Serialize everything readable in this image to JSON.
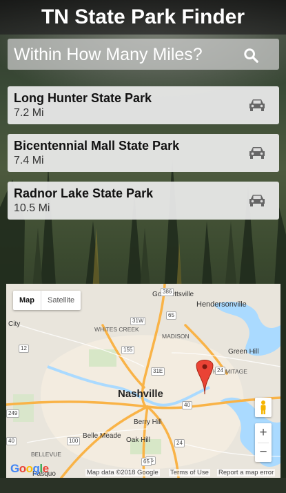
{
  "header": {
    "title": "TN State Park Finder"
  },
  "search": {
    "label": "Within How Many Miles?",
    "icon": "search-icon"
  },
  "parks": [
    {
      "name": "Long Hunter State Park",
      "distance": "7.2 Mi",
      "icon": "car-icon"
    },
    {
      "name": "Bicentennial Mall State Park",
      "distance": "7.4 Mi",
      "icon": "car-icon"
    },
    {
      "name": "Radnor Lake State Park",
      "distance": "10.5 Mi",
      "icon": "car-icon"
    }
  ],
  "map": {
    "type_buttons": {
      "map": "Map",
      "satellite": "Satellite"
    },
    "zoom_in": "+",
    "zoom_out": "−",
    "labels": {
      "goodlettsville": "Goodlettsville",
      "hendersonville": "Hendersonville",
      "city": "City",
      "whites_creek": "WHITES CREEK",
      "madison": "MADISON",
      "green_hill": "Green Hill",
      "hermitage": "HERMITAGE",
      "nashville": "Nashville",
      "berry_hill": "Berry Hill",
      "belle_meade": "Belle Meade",
      "oak_hill": "Oak Hill",
      "bellevue": "BELLEVUE",
      "pasquo": "Pasquo"
    },
    "highway_shields": [
      "386",
      "65",
      "31W",
      "155",
      "31E",
      "24",
      "40",
      "65",
      "100",
      "12",
      "249",
      "40",
      "24",
      "65"
    ],
    "attribution": {
      "data": "Map data ©2018 Google",
      "terms": "Terms of Use",
      "report": "Report a map error"
    },
    "logo": "Google",
    "colors": {
      "water": "#aadaff",
      "highway": "#f9b347",
      "marker": "#ea4335",
      "urban": "#f3ece0"
    }
  }
}
